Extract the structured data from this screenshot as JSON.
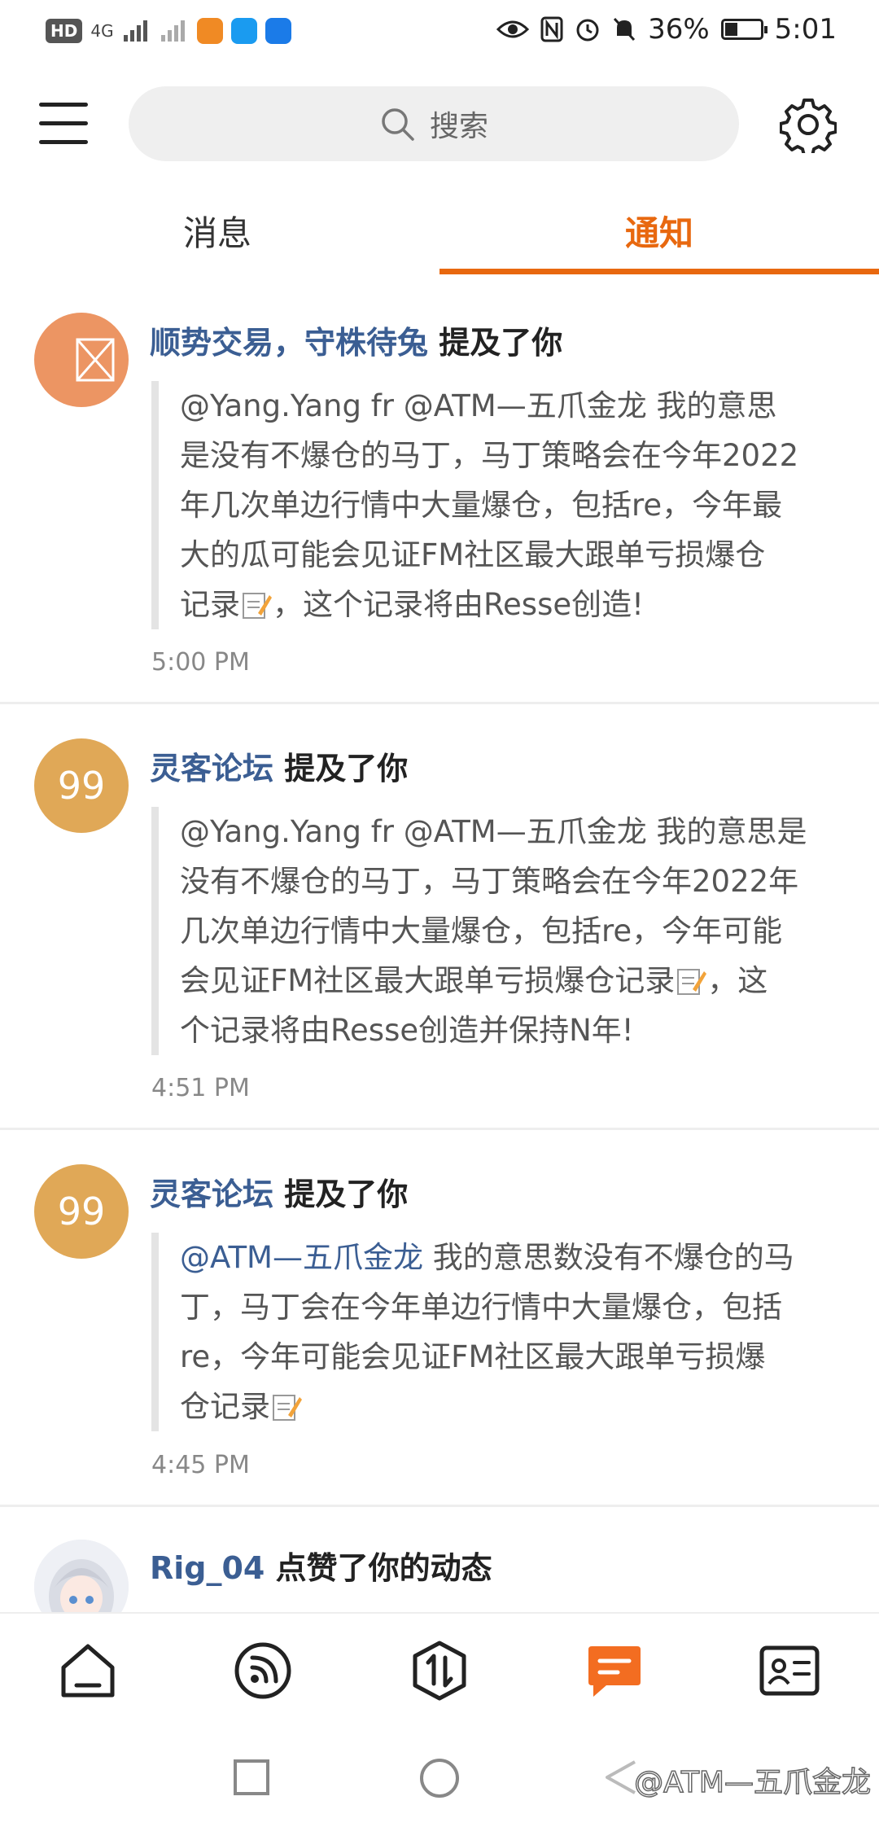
{
  "status_bar": {
    "left_chip": "HD",
    "signal_1": "4G",
    "battery_text": "36%",
    "battery_level": 0.36,
    "time": "5:01"
  },
  "header": {
    "search_placeholder": "搜索"
  },
  "tabs": [
    {
      "label": "消息",
      "active": false
    },
    {
      "label": "通知",
      "active": true
    }
  ],
  "accent_color": "#e8680f",
  "notifications": [
    {
      "user": "顺势交易，守株待兔",
      "action": "提及了你",
      "avatar_text": "",
      "avatar_color": "#ec9563",
      "lines": [
        "@Yang.Yang fr @ATM—五爪金龙  我的意思",
        "是没有不爆仓的马丁，马丁策略会在今年2022",
        "年几次单边行情中大量爆仓，包括re，今年最",
        "大的瓜可能会见证FM社区最大跟单亏损爆仓",
        "记录",
        "，这个记录将由Resse创造!"
      ],
      "time": "5:00 PM"
    },
    {
      "user": "灵客论坛",
      "action": "提及了你",
      "avatar_text": "99",
      "avatar_color": "#e0a857",
      "lines": [
        "@Yang.Yang fr @ATM—五爪金龙 我的意思是",
        "没有不爆仓的马丁，马丁策略会在今年2022年",
        "几次单边行情中大量爆仓，包括re，今年可能",
        "会见证FM社区最大跟单亏损爆仓记录",
        "，这",
        "个记录将由Resse创造并保持N年!"
      ],
      "time": "4:51 PM"
    },
    {
      "user": "灵客论坛",
      "action": "提及了你",
      "avatar_text": "99",
      "avatar_color": "#e0a857",
      "mention": "@ATM—五爪金龙",
      "lines": [
        " 我的意思数没有不爆仓的马",
        "丁，马丁会在今年单边行情中大量爆仓，包括",
        "re，今年可能会见证FM社区最大跟单亏损爆",
        "仓记录"
      ],
      "time": "4:45 PM"
    },
    {
      "user": "Rig_04",
      "action": "点赞了你的动态"
    }
  ],
  "bottom_nav": [
    {
      "icon": "home-icon",
      "active": false
    },
    {
      "icon": "feed-icon",
      "active": false
    },
    {
      "icon": "trade-icon",
      "active": false
    },
    {
      "icon": "message-icon",
      "active": true
    },
    {
      "icon": "profile-card-icon",
      "active": false
    }
  ],
  "watermark": "@ATM—五爪金龙"
}
